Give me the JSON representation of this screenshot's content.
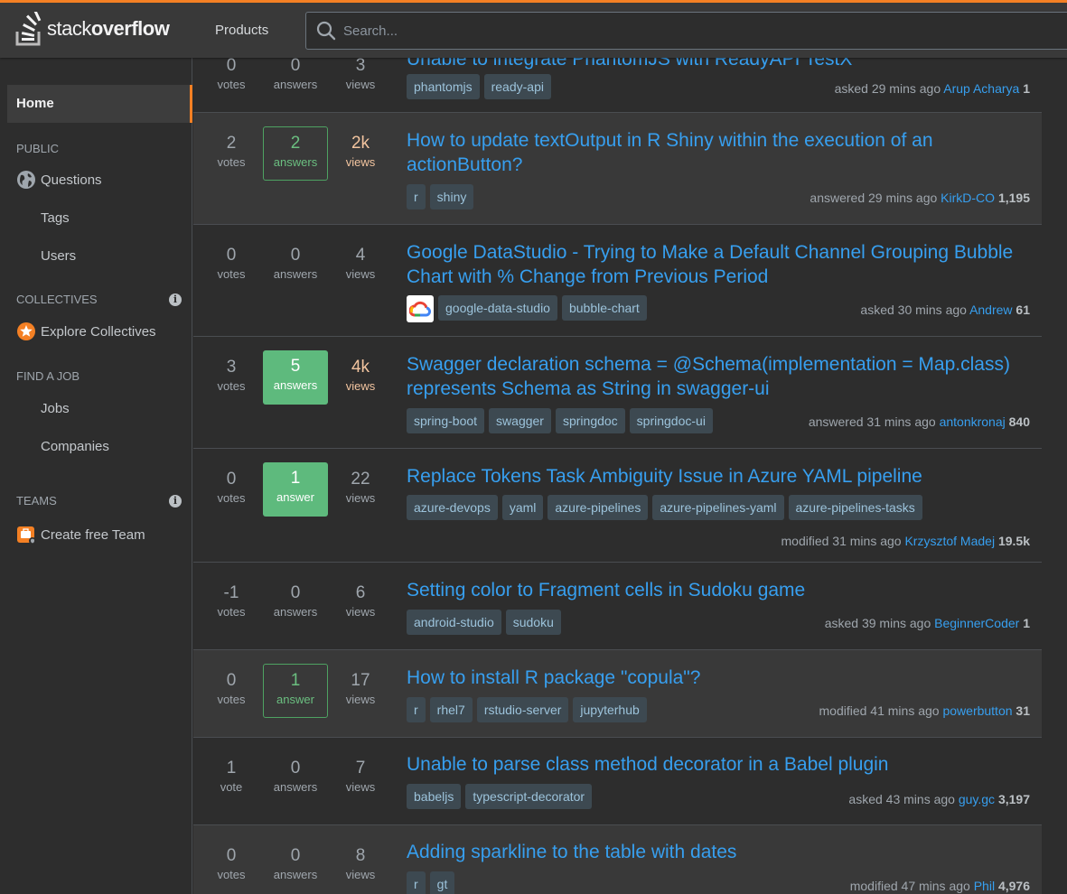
{
  "header": {
    "logo_light": "stack",
    "logo_bold": "overflow",
    "products_label": "Products",
    "search_placeholder": "Search..."
  },
  "sidebar": {
    "home": "Home",
    "public_label": "PUBLIC",
    "questions": "Questions",
    "tags": "Tags",
    "users": "Users",
    "collectives_label": "COLLECTIVES",
    "explore_collectives": "Explore Collectives",
    "find_job_label": "FIND A JOB",
    "jobs": "Jobs",
    "companies": "Companies",
    "teams_label": "TEAMS",
    "create_team": "Create free Team",
    "info_glyph": "i"
  },
  "questions": [
    {
      "votes": "0",
      "votes_label": "votes",
      "answers": "0",
      "answers_label": "answers",
      "answer_style": "plain",
      "views": "3",
      "views_label": "views",
      "views_hot": false,
      "title": "Unable to integrate PhantomJS with ReadyAPI TestX",
      "tags": [
        "phantomjs",
        "ready-api"
      ],
      "action": "asked 29 mins ago",
      "user": "Arup Acharya",
      "rep": "1",
      "highlight": false
    },
    {
      "votes": "2",
      "votes_label": "votes",
      "answers": "2",
      "answers_label": "answers",
      "answer_style": "outline",
      "views": "2k",
      "views_label": "views",
      "views_hot": true,
      "title": "How to update textOutput in R Shiny within the execution of an actionButton?",
      "tags": [
        "r",
        "shiny"
      ],
      "action": "answered 29 mins ago",
      "user": "KirkD-CO",
      "rep": "1,195",
      "highlight": true
    },
    {
      "votes": "0",
      "votes_label": "votes",
      "answers": "0",
      "answers_label": "answers",
      "answer_style": "plain",
      "views": "4",
      "views_label": "views",
      "views_hot": false,
      "title": "Google DataStudio - Trying to Make a Default Channel Grouping Bubble Chart with % Change from Previous Period",
      "tags": [
        "google-data-studio",
        "bubble-chart"
      ],
      "action": "asked 30 mins ago",
      "user": "Andrew",
      "rep": "61",
      "highlight": false
    },
    {
      "votes": "3",
      "votes_label": "votes",
      "answers": "5",
      "answers_label": "answers",
      "answer_style": "filled",
      "views": "4k",
      "views_label": "views",
      "views_hot": true,
      "title": "Swagger declaration schema = @Schema(implementation = Map.class) represents Schema as String in swagger-ui",
      "tags": [
        "spring-boot",
        "swagger",
        "springdoc",
        "springdoc-ui"
      ],
      "action": "answered 31 mins ago",
      "user": "antonkronaj",
      "rep": "840",
      "highlight": false
    },
    {
      "votes": "0",
      "votes_label": "votes",
      "answers": "1",
      "answers_label": "answer",
      "answer_style": "filled",
      "views": "22",
      "views_label": "views",
      "views_hot": false,
      "title": "Replace Tokens Task Ambiguity Issue in Azure YAML pipeline",
      "tags": [
        "azure-devops",
        "yaml",
        "azure-pipelines",
        "azure-pipelines-yaml",
        "azure-pipelines-tasks"
      ],
      "action": "modified 31 mins ago",
      "user": "Krzysztof Madej",
      "rep": "19.5k",
      "highlight": false
    },
    {
      "votes": "-1",
      "votes_label": "votes",
      "answers": "0",
      "answers_label": "answers",
      "answer_style": "plain",
      "views": "6",
      "views_label": "views",
      "views_hot": false,
      "title": "Setting color to Fragment cells in Sudoku game",
      "tags": [
        "android-studio",
        "sudoku"
      ],
      "action": "asked 39 mins ago",
      "user": "BeginnerCoder",
      "rep": "1",
      "highlight": false
    },
    {
      "votes": "0",
      "votes_label": "votes",
      "answers": "1",
      "answers_label": "answer",
      "answer_style": "outline",
      "views": "17",
      "views_label": "views",
      "views_hot": false,
      "title": "How to install R package \"copula\"?",
      "tags": [
        "r",
        "rhel7",
        "rstudio-server",
        "jupyterhub"
      ],
      "action": "modified 41 mins ago",
      "user": "powerbutton",
      "rep": "31",
      "highlight": true
    },
    {
      "votes": "1",
      "votes_label": "vote",
      "answers": "0",
      "answers_label": "answers",
      "answer_style": "plain",
      "views": "7",
      "views_label": "views",
      "views_hot": false,
      "title": "Unable to parse class method decorator in a Babel plugin",
      "tags": [
        "babeljs",
        "typescript-decorator"
      ],
      "action": "asked 43 mins ago",
      "user": "guy.gc",
      "rep": "3,197",
      "highlight": false
    },
    {
      "votes": "0",
      "votes_label": "votes",
      "answers": "0",
      "answers_label": "answers",
      "answer_style": "plain",
      "views": "8",
      "views_label": "views",
      "views_hot": false,
      "title": "Adding sparkline to the table with dates",
      "tags": [
        "r",
        "gt"
      ],
      "action": "modified 47 mins ago",
      "user": "Phil",
      "rep": "4,976",
      "highlight": true
    }
  ],
  "colors": {
    "accent": "#f48024",
    "link": "#379fef",
    "answered_green": "#5eba7d",
    "tag_bg": "#3d4951",
    "tag_text": "#9cc3db",
    "hot_views": "#f2c49f"
  }
}
